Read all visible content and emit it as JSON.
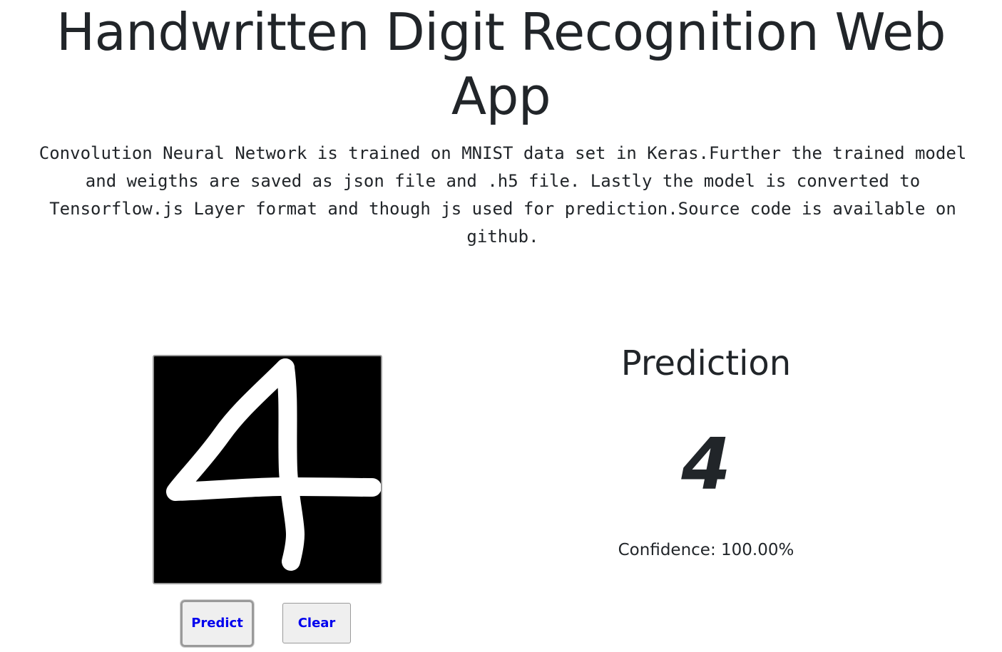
{
  "header": {
    "title": "Handwritten Digit Recognition Web App",
    "description": "Convolution Neural Network is trained on MNIST data set in Keras.Further the trained model and weigths are saved as json file and .h5 file. Lastly the model is converted to Tensorflow.js Layer format and though js used for prediction.Source code is available on github."
  },
  "canvas": {
    "background": "#000000",
    "stroke_color": "#ffffff",
    "drawn_digit": "4"
  },
  "buttons": {
    "predict_label": "Predict",
    "clear_label": "Clear"
  },
  "prediction": {
    "heading": "Prediction",
    "digit": "4",
    "confidence_label": "Confidence:",
    "confidence_value": "100.00%"
  },
  "colors": {
    "text": "#212529",
    "button_text": "#0000ee",
    "button_bg": "#efefef"
  }
}
